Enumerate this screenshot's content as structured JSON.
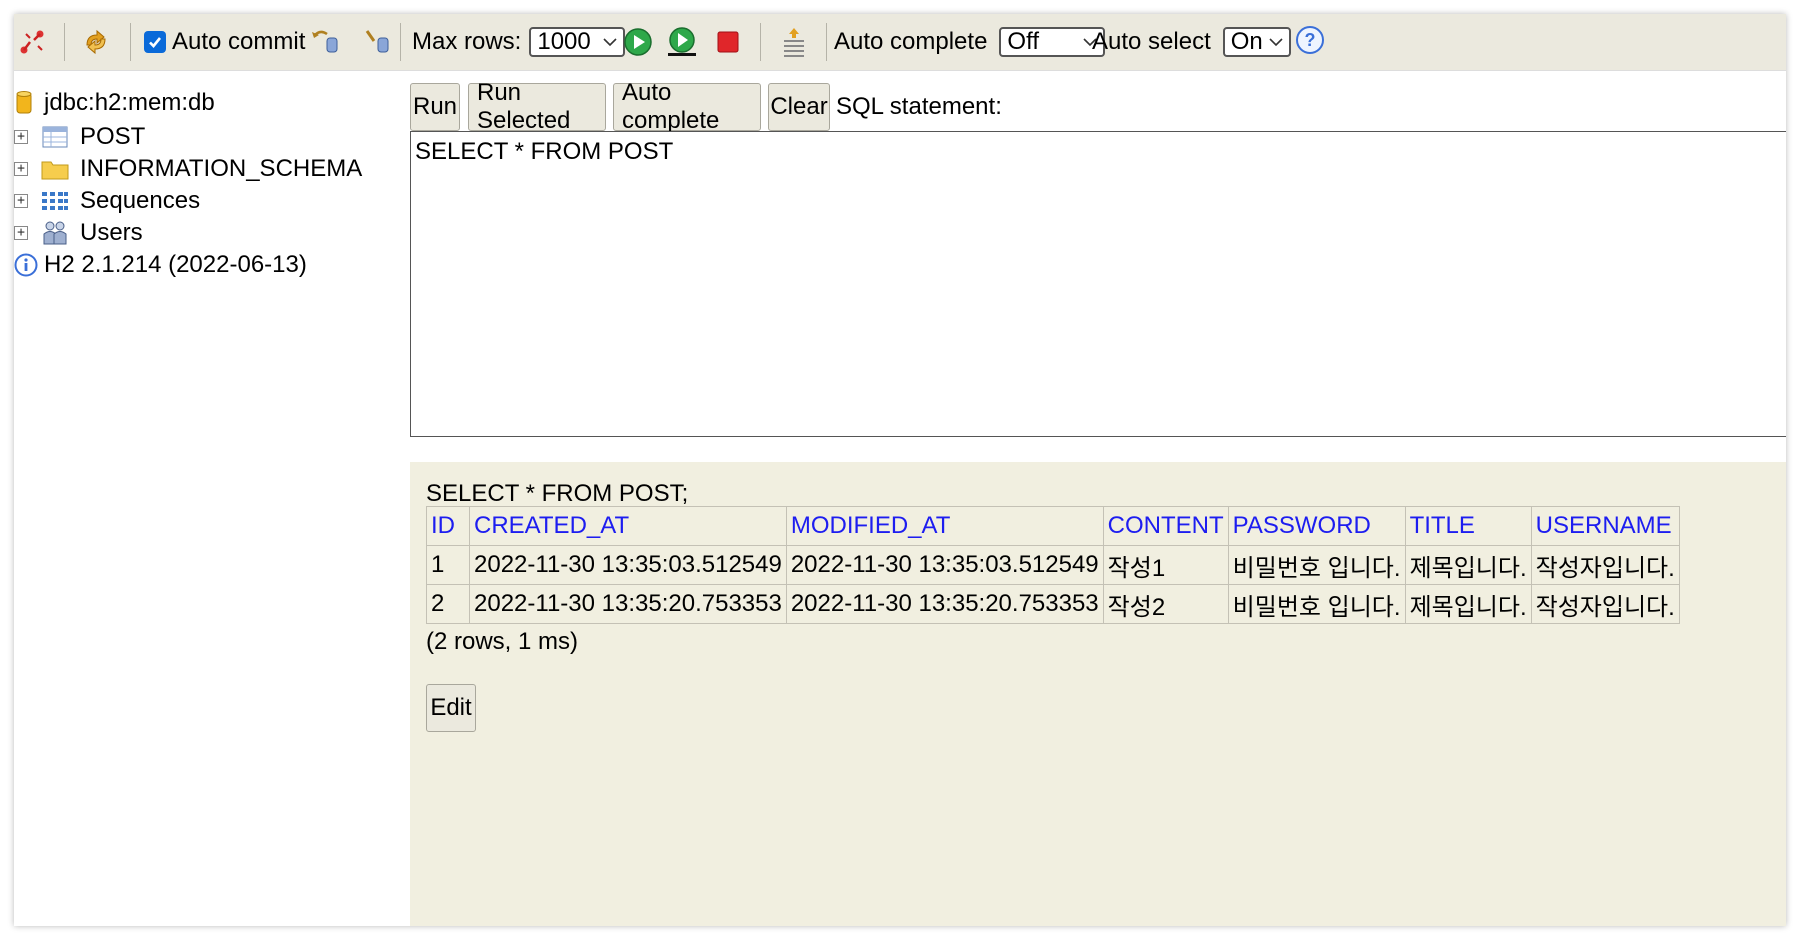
{
  "toolbar": {
    "auto_commit_label": "Auto commit",
    "max_rows_label": "Max rows:",
    "max_rows_value": "1000",
    "auto_complete_label": "Auto complete",
    "auto_complete_value": "Off",
    "auto_select_label": "Auto select",
    "auto_select_value": "On",
    "help_glyph": "?"
  },
  "tree": {
    "connection": "jdbc:h2:mem:db",
    "items": [
      {
        "label": "POST",
        "icon": "table-icon"
      },
      {
        "label": "INFORMATION_SCHEMA",
        "icon": "folder-icon"
      },
      {
        "label": "Sequences",
        "icon": "sequences-icon"
      },
      {
        "label": "Users",
        "icon": "users-icon"
      }
    ],
    "version": "H2 2.1.214 (2022-06-13)"
  },
  "actions": {
    "run": "Run",
    "run_selected": "Run Selected",
    "auto_complete": "Auto complete",
    "clear": "Clear",
    "sql_statement_label": "SQL statement:"
  },
  "editor": {
    "sql": "SELECT * FROM POST"
  },
  "results": {
    "query": "SELECT * FROM POST;",
    "columns": [
      "ID",
      "CREATED_AT",
      "MODIFIED_AT",
      "CONTENT",
      "PASSWORD",
      "TITLE",
      "USERNAME"
    ],
    "rows": [
      [
        "1",
        "2022-11-30 13:35:03.512549",
        "2022-11-30 13:35:03.512549",
        "작성1",
        "비밀번호 입니다.",
        "제목입니다.",
        "작성자입니다."
      ],
      [
        "2",
        "2022-11-30 13:35:20.753353",
        "2022-11-30 13:35:20.753353",
        "작성2",
        "비밀번호 입니다.",
        "제목입니다.",
        "작성자입니다."
      ]
    ],
    "summary": "(2 rows, 1 ms)",
    "edit_label": "Edit"
  },
  "colors": {
    "toolbar_bg": "#ebe9de",
    "results_bg": "#f1efe0",
    "header_link": "#1d1df0"
  }
}
